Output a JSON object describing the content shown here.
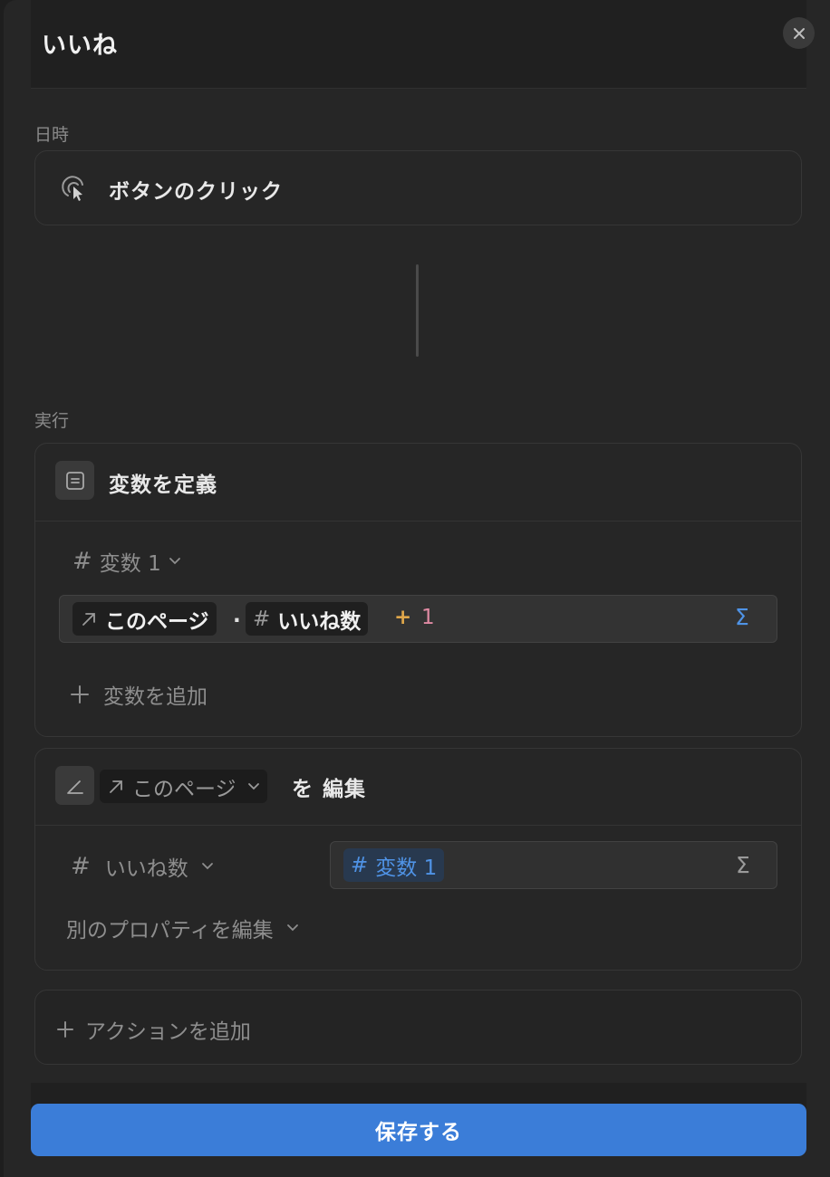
{
  "header": {
    "title": "いいね"
  },
  "trigger": {
    "section_label": "日時",
    "label": "ボタンのクリック"
  },
  "execution": {
    "section_label": "実行",
    "define_variable": {
      "title": "変数を定義",
      "variable_name": "変数 1",
      "formula": {
        "page_chip": "このページ",
        "dot": ".",
        "property_chip": "いいね数",
        "operator": "+",
        "operand": "1"
      },
      "add_variable_label": "変数を追加"
    },
    "edit_page": {
      "target_chip": "このページ",
      "particle": "を",
      "action": "編集",
      "property_name": "いいね数",
      "value_chip": "変数 1",
      "edit_other_label": "別のプロパティを編集"
    },
    "add_action_label": "アクションを追加"
  },
  "footer": {
    "save_label": "保存する"
  },
  "icons": {
    "close": "close-icon",
    "click": "click-cursor-icon",
    "variable": "variable-icon",
    "edit": "pencil-icon",
    "number": "hash-icon",
    "relation": "arrow-up-right-icon",
    "chevron": "chevron-down-icon",
    "plus": "plus-icon",
    "formula": "sigma-icon"
  },
  "colors": {
    "accent": "#3b7dd8",
    "number_blue": "#4f93e6",
    "operator": "#e0a74a",
    "operand": "#e08aa3"
  }
}
